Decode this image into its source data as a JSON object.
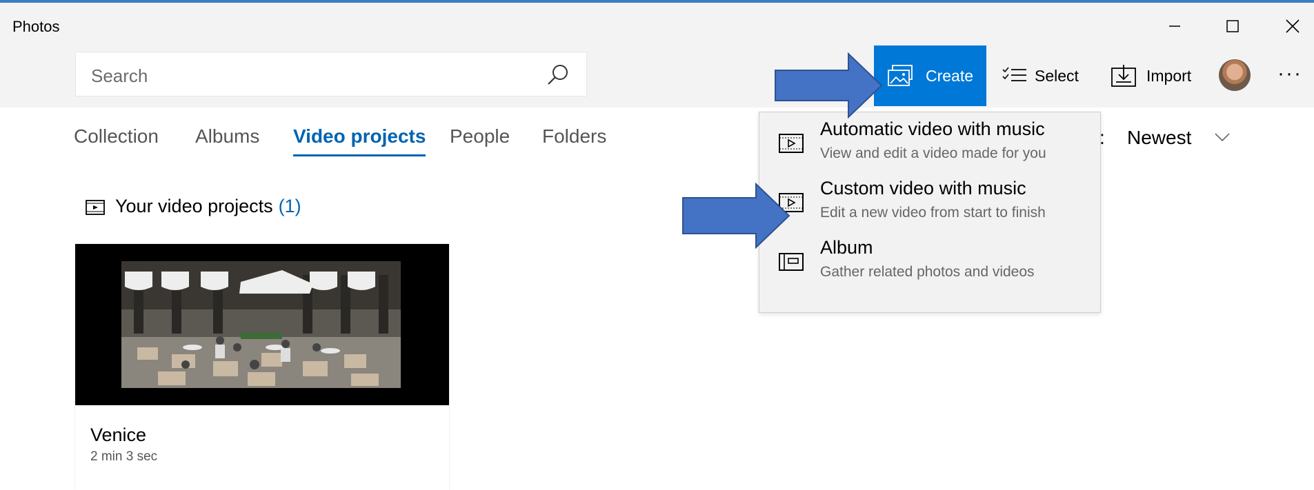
{
  "app": {
    "title": "Photos"
  },
  "window_controls": {
    "minimize_icon": "minimize-icon",
    "maximize_icon": "maximize-icon",
    "close_icon": "close-icon"
  },
  "search": {
    "placeholder": "Search",
    "icon": "search-icon"
  },
  "toolbar": {
    "create_label": "Create",
    "select_label": "Select",
    "import_label": "Import",
    "more_label": "···"
  },
  "nav": {
    "tabs": [
      {
        "label": "Collection",
        "active": false
      },
      {
        "label": "Albums",
        "active": false
      },
      {
        "label": "Video projects",
        "active": true
      },
      {
        "label": "People",
        "active": false
      },
      {
        "label": "Folders",
        "active": false
      }
    ]
  },
  "sort": {
    "label_partial": "y:",
    "value": "Newest"
  },
  "section": {
    "title": "Your video projects",
    "count": "(1)"
  },
  "projects": [
    {
      "title": "Venice",
      "duration": "2 min 3 sec"
    }
  ],
  "create_menu": {
    "items": [
      {
        "title": "Automatic video with music",
        "description": "View and edit a video made for you",
        "icon": "video-project-icon"
      },
      {
        "title": "Custom video with music",
        "description": "Edit a new video from start to finish",
        "icon": "video-project-icon"
      },
      {
        "title": "Album",
        "description": "Gather related photos and videos",
        "icon": "album-icon"
      }
    ]
  },
  "colors": {
    "accent": "#0078d7",
    "active_tab": "#0063b1",
    "annotation_arrow": "#4472c4"
  }
}
